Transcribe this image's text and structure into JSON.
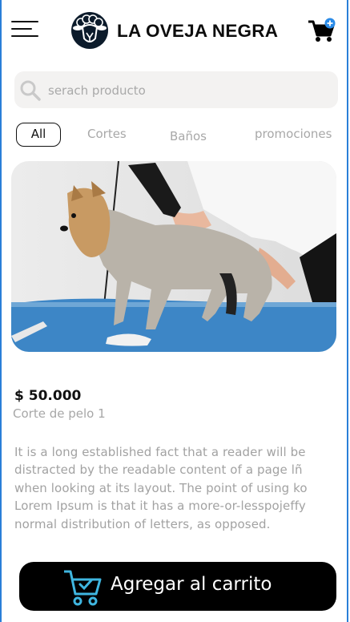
{
  "header": {
    "brand": "LA OVEJA NEGRA",
    "menu_icon": "hamburger-menu-icon",
    "logo_icon": "black-sheep-logo",
    "cart_icon": "shopping-cart-icon",
    "cart_badge_icon": "plus-badge-icon"
  },
  "search": {
    "placeholder": "serach producto",
    "icon": "search-icon"
  },
  "tabs": [
    {
      "label": "All",
      "active": true
    },
    {
      "label": "Cortes"
    },
    {
      "label": "Baños"
    },
    {
      "label": "promociones"
    }
  ],
  "product": {
    "price": "$ 50.000",
    "name": "Corte de pelo 1",
    "description_lines": [
      "It is a long established fact that a reader will be",
      "distracted by the readable content of a page lñ",
      "when looking at its layout. The point of using ko",
      "Lorem Ipsum is that it has a more-or-lesspojeffy",
      "normal distribution of letters, as opposed."
    ]
  },
  "cta": {
    "label": "Agregar al carrito",
    "icon": "cart-check-icon",
    "icon_color": "#3fb6e0"
  },
  "colors": {
    "accent": "#2a8be8",
    "text": "#111111",
    "muted": "#a7a7a7"
  }
}
